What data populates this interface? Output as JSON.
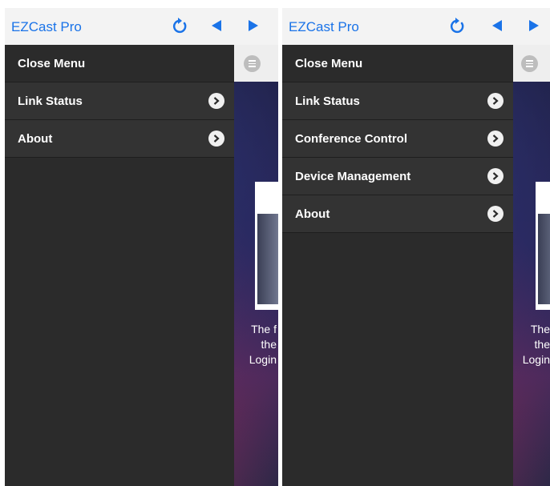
{
  "screens": [
    {
      "app_title": "EZCast Pro",
      "menu": [
        {
          "label": "Close Menu",
          "has_arrow": false
        },
        {
          "label": "Link Status",
          "has_arrow": true
        },
        {
          "label": "About",
          "has_arrow": true
        }
      ],
      "content_text": [
        "The f",
        "the",
        "Login"
      ]
    },
    {
      "app_title": "EZCast Pro",
      "menu": [
        {
          "label": "Close Menu",
          "has_arrow": false
        },
        {
          "label": "Link Status",
          "has_arrow": true
        },
        {
          "label": "Conference Control",
          "has_arrow": true
        },
        {
          "label": "Device Management",
          "has_arrow": true
        },
        {
          "label": "About",
          "has_arrow": true
        }
      ],
      "content_text": [
        "The",
        "the",
        "Login"
      ]
    }
  ],
  "icons": {
    "refresh": "refresh-icon",
    "back": "back-arrow-icon",
    "forward": "forward-arrow-icon",
    "menu": "menu-icon",
    "chevron": "chevron-right-icon"
  },
  "colors": {
    "accent": "#1a73e8",
    "drawer_bg": "#2b2b2b",
    "drawer_item_alt": "#333333"
  }
}
